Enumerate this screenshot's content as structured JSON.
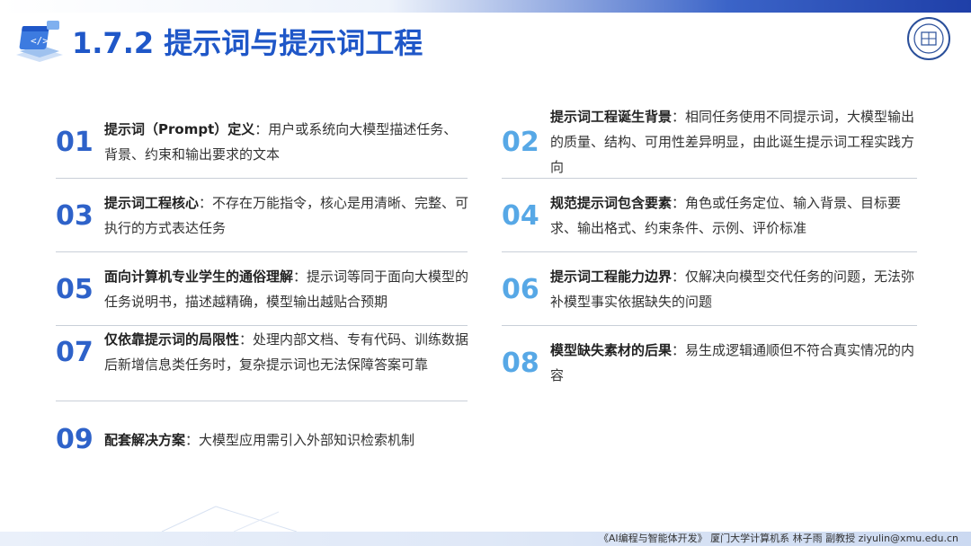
{
  "header": {
    "title": "1.7.2 提示词与提示词工程"
  },
  "items": [
    {
      "num": "01",
      "head": "提示词（Prompt）定义",
      "body": "：用户或系统向大模型描述任务、背景、约束和输出要求的文本"
    },
    {
      "num": "02",
      "head": "提示词工程诞生背景",
      "body": "：相同任务使用不同提示词，大模型输出的质量、结构、可用性差异明显，由此诞生提示词工程实践方向"
    },
    {
      "num": "03",
      "head": "提示词工程核心",
      "body": "：不存在万能指令，核心是用清晰、完整、可执行的方式表达任务"
    },
    {
      "num": "04",
      "head": "规范提示词包含要素",
      "body": "：角色或任务定位、输入背景、目标要求、输出格式、约束条件、示例、评价标准"
    },
    {
      "num": "05",
      "head": "面向计算机专业学生的通俗理解",
      "body": "：提示词等同于面向大模型的任务说明书，描述越精确，模型输出越贴合预期"
    },
    {
      "num": "06",
      "head": "提示词工程能力边界",
      "body": "：仅解决向模型交代任务的问题，无法弥补模型事实依据缺失的问题"
    },
    {
      "num": "07",
      "head": "仅依靠提示词的局限性",
      "body": "：处理内部文档、专有代码、训练数据后新增信息类任务时，复杂提示词也无法保障答案可靠"
    },
    {
      "num": "08",
      "head": "模型缺失素材的后果",
      "body": "：易生成逻辑通顺但不符合真实情况的内容"
    },
    {
      "num": "09",
      "head": "配套解决方案",
      "body": "：大模型应用需引入外部知识检索机制"
    }
  ],
  "footer": {
    "text": "《AI编程与智能体开发》  厦门大学计算机系  林子雨  副教授  ziyulin@xmu.edu.cn"
  },
  "colors": {
    "title": "#1f57c8",
    "num_dark": "#2e62c9",
    "num_light": "#57a8e6"
  },
  "icons": {
    "title_icon": "code-window-icon",
    "logo": "university-seal"
  }
}
